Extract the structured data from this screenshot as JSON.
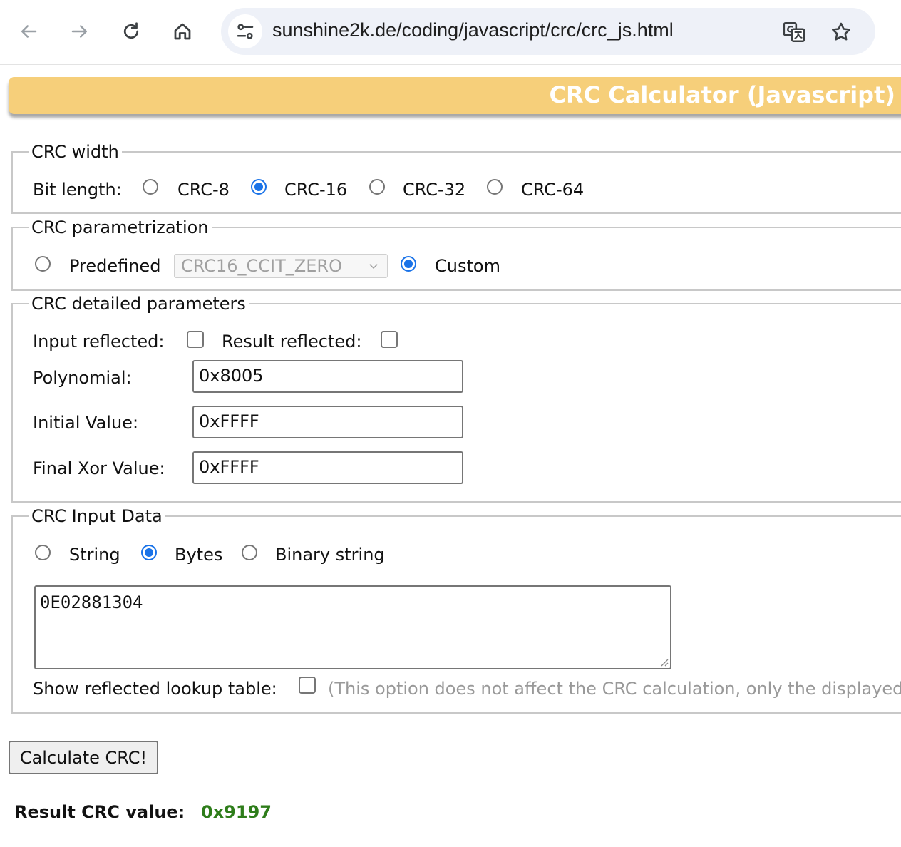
{
  "browser": {
    "url": "sunshine2k.de/coding/javascript/crc/crc_js.html"
  },
  "banner": {
    "title": "CRC Calculator (Javascript)"
  },
  "crc_width": {
    "legend": "CRC width",
    "label": "Bit length:",
    "options": [
      "CRC-8",
      "CRC-16",
      "CRC-32",
      "CRC-64"
    ],
    "selected": "CRC-16"
  },
  "parametrization": {
    "legend": "CRC parametrization",
    "predefined_label": "Predefined",
    "predefined_value": "CRC16_CCIT_ZERO",
    "custom_label": "Custom",
    "selected": "Custom"
  },
  "detailed": {
    "legend": "CRC detailed parameters",
    "input_reflected_label": "Input reflected:",
    "result_reflected_label": "Result reflected:",
    "polynomial_label": "Polynomial:",
    "polynomial_value": "0x8005",
    "initial_label": "Initial Value:",
    "initial_value": "0xFFFF",
    "final_xor_label": "Final Xor Value:",
    "final_xor_value": "0xFFFF"
  },
  "input_data": {
    "legend": "CRC Input Data",
    "options": [
      "String",
      "Bytes",
      "Binary string"
    ],
    "selected": "Bytes",
    "value": "0E02881304",
    "lookup_label": "Show reflected lookup table:",
    "lookup_note": "(This option does not affect the CRC calculation, only the displayed"
  },
  "calculate_label": "Calculate CRC!",
  "result": {
    "label": "Result CRC value:",
    "value": "0x9197"
  },
  "colors": {
    "banner": "#f6cf7a",
    "accent": "#1a73e8",
    "result": "#2e7d1a"
  }
}
